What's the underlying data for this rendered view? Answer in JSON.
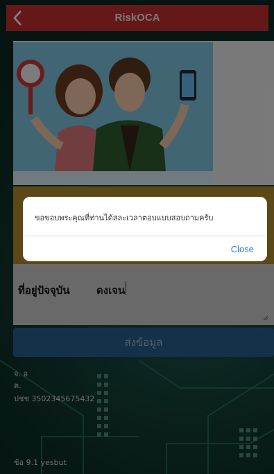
{
  "header": {
    "title": "RiskOCA",
    "back_icon": "chevron-left-icon"
  },
  "illustration": {
    "name": "two-people-illustration"
  },
  "form": {
    "address_label": "ที่อยู่ปัจจุบัน",
    "address_value": "ดงเจน",
    "submit_label": "ส่งข้อมูล"
  },
  "footer_info": {
    "line1": "จ. อ",
    "line2": "ต.",
    "line3": "ปชช 3502345675432",
    "line4": "ข้อ 9.1 yesbut"
  },
  "dialog": {
    "message": "ขอขอบพระคุณที่ท่านได้สละเวลาตอบแบบสอบถามครับ",
    "close_label": "Close"
  },
  "colors": {
    "header": "#c0302e",
    "submit": "#2a5e8e",
    "panel": "#b18a2b",
    "close_link": "#2b7bd8"
  }
}
